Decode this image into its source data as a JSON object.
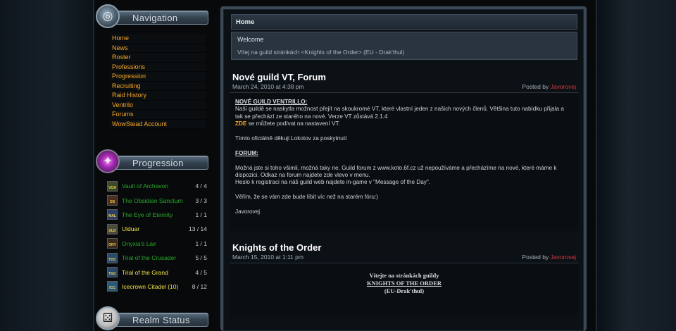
{
  "sidebar": {
    "navigation": {
      "title": "Navigation",
      "items": [
        "Home",
        "News",
        "Roster",
        "Professions",
        "Progression",
        "Recruiting",
        "Raid History",
        "Ventrilo",
        "Forums",
        "WowStead Account"
      ]
    },
    "progression": {
      "title": "Progression",
      "items": [
        {
          "icon": "VOA",
          "name": "Vault of Archavon",
          "count": "4 / 4",
          "color": "green"
        },
        {
          "icon": "OS",
          "name": "The Obsidian Sanctum",
          "count": "3 / 3",
          "color": "green"
        },
        {
          "icon": "MAL",
          "name": "The Eye of Eternity",
          "count": "1 / 1",
          "color": "green"
        },
        {
          "icon": "ULD",
          "name": "Ulduar",
          "count": "13 / 14",
          "color": "yellow"
        },
        {
          "icon": "ONY",
          "name": "Onyxia's Lair",
          "count": "1 / 1",
          "color": "green"
        },
        {
          "icon": "TOC",
          "name": "Trial of the Crusader",
          "count": "5 / 5",
          "color": "green"
        },
        {
          "icon": "TGC",
          "name": "Trial of the Grand",
          "count": "4 / 5",
          "color": "yellow"
        },
        {
          "icon": "ICC",
          "name": "Icecrown Citadel (10)",
          "count": "8 / 12",
          "color": "yellow"
        }
      ]
    },
    "realm_status": {
      "title": "Realm Status"
    }
  },
  "breadcrumb": {
    "home": "Home"
  },
  "welcome": {
    "title": "Welcome",
    "text": "Vítej na guild stránkách <Knights of the Order> (EU - Drak'thul)"
  },
  "posts": [
    {
      "title": "Nové guild VT, Forum",
      "date": "March 24, 2010 at 4:38 pm",
      "posted_by": "Posted by",
      "author": "Javorovej",
      "body": {
        "vent_heading": "NOVÉ GUILD VENTRILLO:",
        "vent_text": "Naší guildě se naskytla možnost přejít na skoukromé VT, které vlastní jeden z našich nových členů. Většina tuto nabídku přijala a tak se přechází ze starého na nové. Verze VT zůstává 2.1.4",
        "zde": "ZDE",
        "zde_text": " se můžete podívat na nastavení VT.",
        "thanks": "Tímto oficiálně děkuji Lokotov za poskytnutí",
        "forum_heading": "FORUM:",
        "forum_text1": "Možná jste si toho všimli, možná taky ne. Guild forum z www.koto.6f.cz už nepoužíváme a přecházíme na nové, které máme k dispozici. Odkaz na forum najdete zde vlevo v menu.",
        "forum_text2": "Heslo k registraci na náš guild web najdete in-game v \"Message of the Day\".",
        "closing": "Věřím, že se vám zde bude líbit víc než na starém fóru:)",
        "signature": "Javorovej"
      }
    },
    {
      "title": "Knights of the Order",
      "date": "March 15, 2010 at 1:11 pm",
      "posted_by": "Posted by",
      "author": "Javorovej",
      "body": {
        "line1": "Vítejte na stránkách guildy",
        "line2": "KNIGHTS OF THE ORDER",
        "line3": "(EU-Drak'thul)"
      }
    }
  ]
}
